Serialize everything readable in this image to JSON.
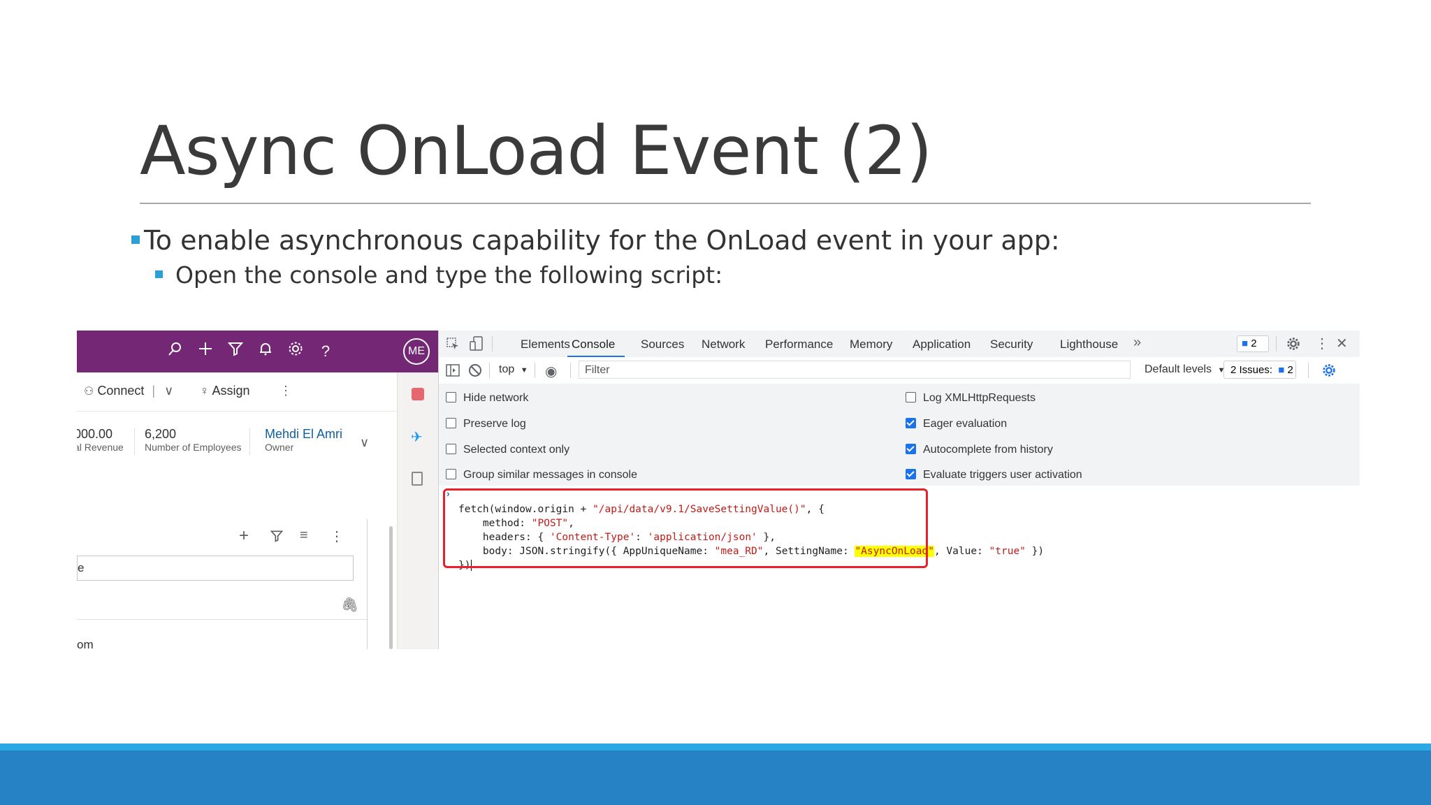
{
  "slide": {
    "title": "Async OnLoad Event (2)",
    "bullet1": "To enable asynchronous capability for the OnLoad event in your app:",
    "bullet2": "Open the console and type the following script:"
  },
  "crm": {
    "avatar": "ME",
    "command_bar": {
      "connect": "Connect",
      "assign": "Assign"
    },
    "fields": [
      {
        "value": "000.00",
        "label": "al Revenue"
      },
      {
        "value": "6,200",
        "label": "Number of Employees"
      },
      {
        "value": "Mehdi El Amri",
        "label": "Owner"
      }
    ],
    "subgrid_text_1": "e",
    "subgrid_text_2": "om"
  },
  "devtools": {
    "tabs": [
      "Elements",
      "Console",
      "Sources",
      "Network",
      "Performance",
      "Memory",
      "Application",
      "Security",
      "Lighthouse"
    ],
    "more_tabs": "»",
    "message_badge": "2",
    "context": "top",
    "filter_placeholder": "Filter",
    "levels": "Default levels",
    "issues_label": "2 Issues:",
    "issues_count": "2",
    "settings_left": [
      {
        "label": "Hide network",
        "checked": false
      },
      {
        "label": "Preserve log",
        "checked": false
      },
      {
        "label": "Selected context only",
        "checked": false
      },
      {
        "label": "Group similar messages in console",
        "checked": false
      }
    ],
    "settings_right": [
      {
        "label": "Log XMLHttpRequests",
        "checked": false
      },
      {
        "label": "Eager evaluation",
        "checked": true
      },
      {
        "label": "Autocomplete from history",
        "checked": true
      },
      {
        "label": "Evaluate triggers user activation",
        "checked": true
      }
    ],
    "code": {
      "line1_a": "fetch(window.origin + ",
      "line1_str": "\"/api/data/v9.1/SaveSettingValue()\"",
      "line1_b": ", {",
      "line2_a": "    method: ",
      "line2_str": "\"POST\"",
      "line2_b": ",",
      "line3_a": "    headers: { ",
      "line3_str1": "'Content-Type'",
      "line3_b": ": ",
      "line3_str2": "'application/json'",
      "line3_c": " },",
      "line4_a": "    body: JSON.stringify({ AppUniqueName: ",
      "line4_str1": "\"mea_RD\"",
      "line4_b": ", SettingName: ",
      "line4_str2": "\"AsyncOnLoad\"",
      "line4_c": ", Value: ",
      "line4_str3": "\"true\"",
      "line4_d": " })",
      "line5": "})"
    }
  },
  "colors": {
    "accent": "#29aae2",
    "footer": "#2782c5",
    "crm_header": "#742774",
    "highlight": "#ffff00",
    "outline": "#e8202a"
  }
}
